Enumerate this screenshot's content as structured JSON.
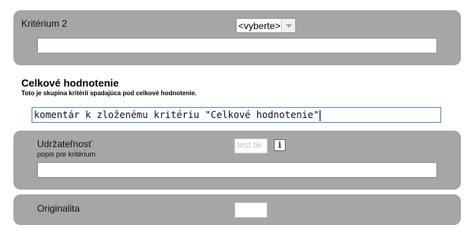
{
  "criterion2": {
    "label": "Kritérium 2",
    "select_value": "<vyberte>",
    "comment_value": ""
  },
  "group": {
    "title": "Celkové hodnotenie",
    "description": "Toto je skupina kritérií spadajúca pod celkové hodnotenie.",
    "comment_value": "komentár k zloženému kritériu \"Celkové hodnotenie\""
  },
  "sustainability": {
    "label": "Udržateľnosť",
    "sublabel": "popis pre kritérium",
    "score_placeholder": "test tie",
    "info_label": "i",
    "comment_value": ""
  },
  "originality": {
    "label": "Originalita",
    "score_value": ""
  }
}
